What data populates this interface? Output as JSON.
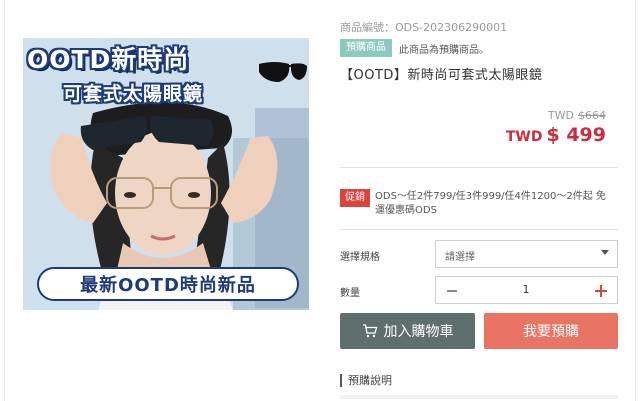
{
  "product": {
    "sku": "商品編號：ODS-202306290001",
    "preorder_badge": "預購商品",
    "preorder_note": "此商品為預購商品。",
    "title": "【OOTD】新時尚可套式太陽眼鏡"
  },
  "image": {
    "headline": "OOTD新時尚",
    "subheadline": "可套式太陽眼鏡",
    "banner": "最新OOTD時尚新品"
  },
  "price": {
    "original_currency": "TWD",
    "original_amount": "$664",
    "sale_currency": "TWD",
    "sale_amount": "$ 499",
    "sale_color": "#cf2b3c"
  },
  "promotion": {
    "badge": "促銷",
    "text": "ODS～任2件799/任3件999/任4件1200～2件起 免運優惠碼ODS"
  },
  "options": {
    "spec_label": "選擇規格",
    "spec_placeholder": "請選擇",
    "qty_label": "數量",
    "qty_value": "1"
  },
  "actions": {
    "add_to_cart": "加入購物車",
    "preorder": "我要預購",
    "cart_color": "#5f6f6e",
    "preorder_color": "#ea7464"
  },
  "notes": {
    "title": "預購說明"
  }
}
